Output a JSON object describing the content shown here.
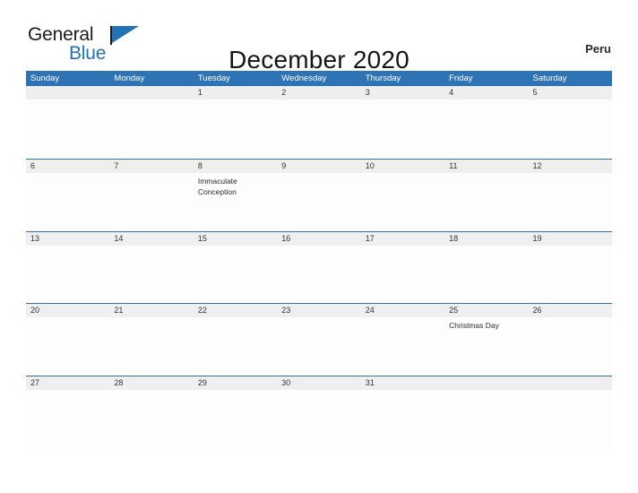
{
  "brand": {
    "name_part1": "General",
    "name_part2": "Blue",
    "flag_icon": "blue-flag-triangle",
    "accent_color": "#2272b8"
  },
  "header": {
    "title": "December 2020",
    "country": "Peru"
  },
  "colors": {
    "header_blue": "#2e74b5",
    "banner_gray": "#efefef",
    "text_dark": "#333333",
    "white": "#ffffff"
  },
  "calendar": {
    "month": "December",
    "year": "2020",
    "weekdays": [
      "Sunday",
      "Monday",
      "Tuesday",
      "Wednesday",
      "Thursday",
      "Friday",
      "Saturday"
    ],
    "weeks": [
      [
        {
          "day": "",
          "event": ""
        },
        {
          "day": "",
          "event": ""
        },
        {
          "day": "1",
          "event": ""
        },
        {
          "day": "2",
          "event": ""
        },
        {
          "day": "3",
          "event": ""
        },
        {
          "day": "4",
          "event": ""
        },
        {
          "day": "5",
          "event": ""
        }
      ],
      [
        {
          "day": "6",
          "event": ""
        },
        {
          "day": "7",
          "event": ""
        },
        {
          "day": "8",
          "event": "Immaculate Conception"
        },
        {
          "day": "9",
          "event": ""
        },
        {
          "day": "10",
          "event": ""
        },
        {
          "day": "11",
          "event": ""
        },
        {
          "day": "12",
          "event": ""
        }
      ],
      [
        {
          "day": "13",
          "event": ""
        },
        {
          "day": "14",
          "event": ""
        },
        {
          "day": "15",
          "event": ""
        },
        {
          "day": "16",
          "event": ""
        },
        {
          "day": "17",
          "event": ""
        },
        {
          "day": "18",
          "event": ""
        },
        {
          "day": "19",
          "event": ""
        }
      ],
      [
        {
          "day": "20",
          "event": ""
        },
        {
          "day": "21",
          "event": ""
        },
        {
          "day": "22",
          "event": ""
        },
        {
          "day": "23",
          "event": ""
        },
        {
          "day": "24",
          "event": ""
        },
        {
          "day": "25",
          "event": "Christmas Day"
        },
        {
          "day": "26",
          "event": ""
        }
      ],
      [
        {
          "day": "27",
          "event": ""
        },
        {
          "day": "28",
          "event": ""
        },
        {
          "day": "29",
          "event": ""
        },
        {
          "day": "30",
          "event": ""
        },
        {
          "day": "31",
          "event": ""
        },
        {
          "day": "",
          "event": ""
        },
        {
          "day": "",
          "event": ""
        }
      ]
    ]
  }
}
